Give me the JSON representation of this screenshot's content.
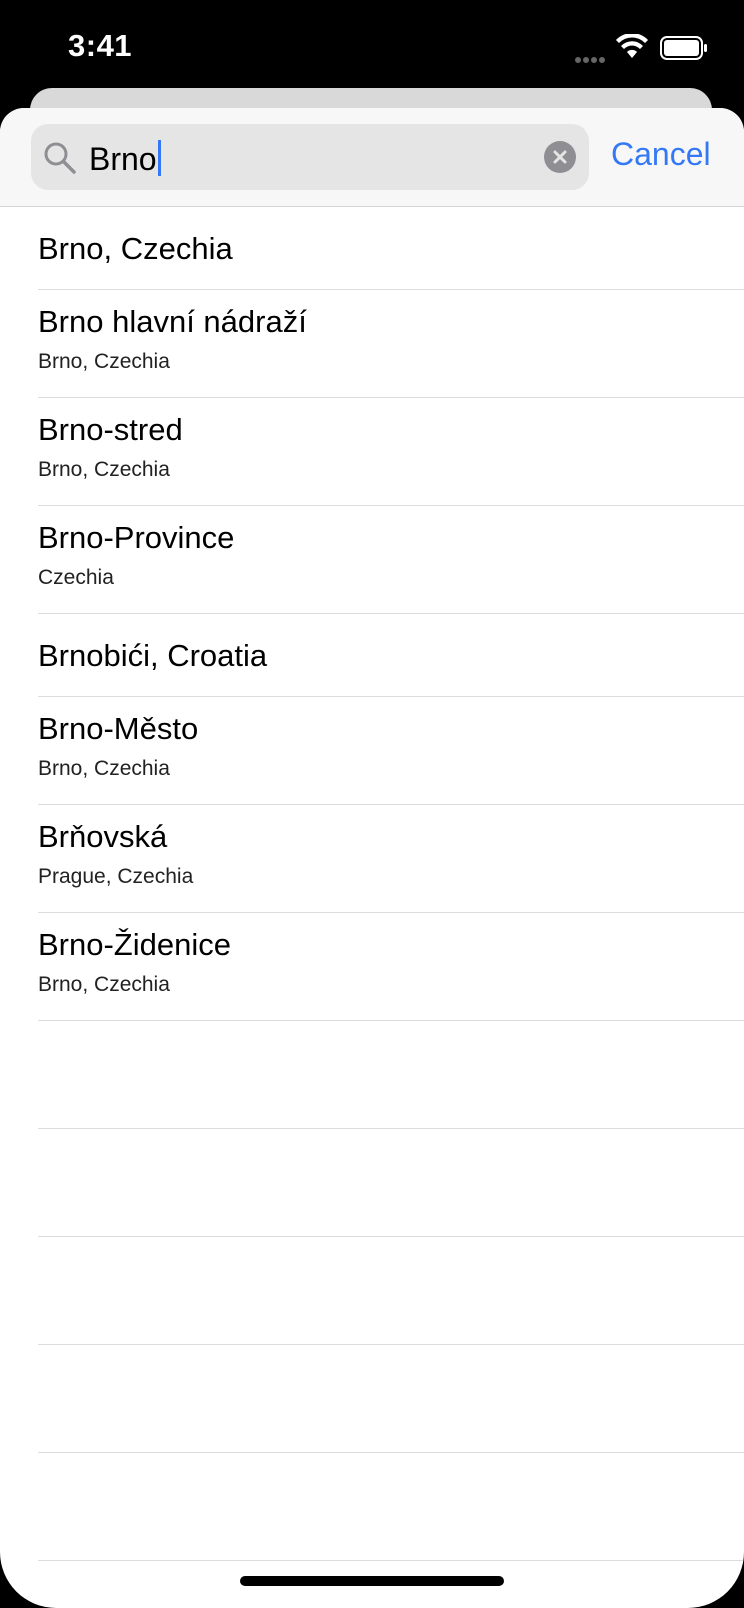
{
  "status": {
    "time": "3:41"
  },
  "search": {
    "query": "Brno",
    "cancel_label": "Cancel"
  },
  "results": [
    {
      "title": "Brno, Czechia",
      "subtitle": ""
    },
    {
      "title": "Brno hlavní nádraží",
      "subtitle": "Brno, Czechia"
    },
    {
      "title": "Brno-stred",
      "subtitle": "Brno, Czechia"
    },
    {
      "title": "Brno-Province",
      "subtitle": "Czechia"
    },
    {
      "title": "Brnobići, Croatia",
      "subtitle": ""
    },
    {
      "title": "Brno-Město",
      "subtitle": "Brno, Czechia"
    },
    {
      "title": "Brňovská",
      "subtitle": "Prague, Czechia"
    },
    {
      "title": "Brno-Židenice",
      "subtitle": "Brno, Czechia"
    }
  ],
  "icons": {
    "search": "search-icon",
    "clear": "clear-icon",
    "wifi": "wifi-icon",
    "battery": "battery-icon",
    "signal": "signal-icon"
  },
  "colors": {
    "accent": "#3478f6",
    "background": "#ffffff",
    "separator": "#dcdcdc"
  }
}
